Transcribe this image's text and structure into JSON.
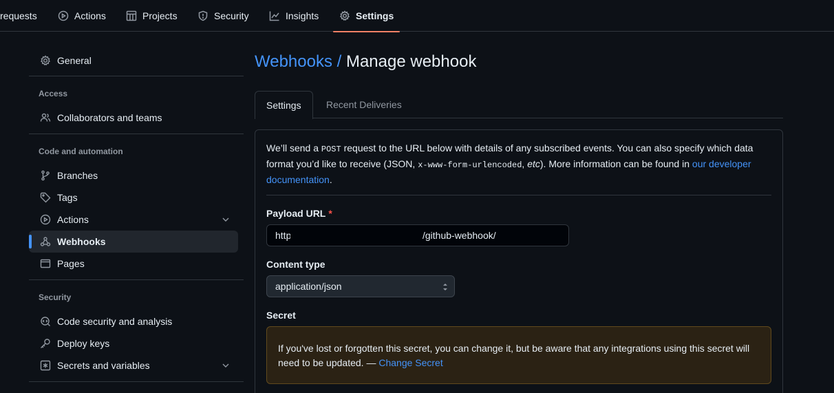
{
  "topnav": {
    "tabs": [
      {
        "label": "requests",
        "icon": "pull-request-icon"
      },
      {
        "label": "Actions",
        "icon": "play-icon"
      },
      {
        "label": "Projects",
        "icon": "table-icon"
      },
      {
        "label": "Security",
        "icon": "shield-icon"
      },
      {
        "label": "Insights",
        "icon": "graph-icon"
      },
      {
        "label": "Settings",
        "icon": "gear-icon"
      }
    ],
    "selected": "Settings",
    "accent": "#f78166"
  },
  "sidebar": {
    "general": "General",
    "sections": [
      {
        "heading": "Access",
        "items": [
          "Collaborators and teams"
        ]
      },
      {
        "heading": "Code and automation",
        "items": [
          "Branches",
          "Tags",
          "Actions",
          "Webhooks",
          "Pages"
        ]
      },
      {
        "heading": "Security",
        "items": [
          "Code security and analysis",
          "Deploy keys",
          "Secrets and variables"
        ]
      }
    ],
    "active_item": "Webhooks",
    "active_accent": "#4493f8"
  },
  "main": {
    "breadcrumb": "Webhooks /",
    "title": "Manage webhook",
    "tabs": [
      {
        "label": "Settings"
      },
      {
        "label": "Recent Deliveries"
      }
    ],
    "selected_tab": "Settings",
    "intro": {
      "part1": "We’ll send a ",
      "method": "POST",
      "part2": " request to the URL below with details of any subscribed events. You can also specify which data format you’d like to receive (JSON, ",
      "format": "x-www-form-urlencoded",
      "part3": ", ",
      "etc": "etc",
      "part4": "). More information can be found in ",
      "link": "our developer documentation",
      "part5": "."
    },
    "payload_url": {
      "label": "Payload URL",
      "required_mark": "*",
      "value_prefix": "http",
      "value_suffix": "/github-webhook/"
    },
    "content_type": {
      "label": "Content type",
      "value": "application/json"
    },
    "secret": {
      "label": "Secret",
      "notice": "If you've lost or forgotten this secret, you can change it, but be aware that any integrations using this secret will need to be updated. — ",
      "link": "Change Secret"
    }
  }
}
